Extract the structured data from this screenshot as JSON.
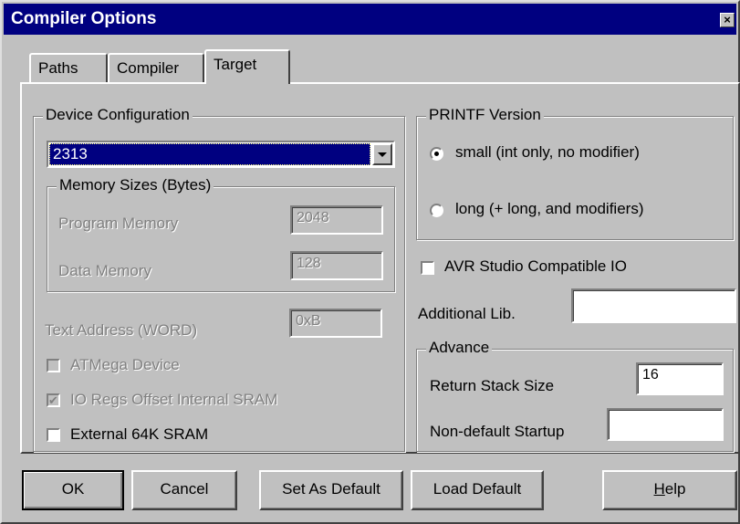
{
  "window": {
    "title": "Compiler Options",
    "close_glyph": "×"
  },
  "tabs": [
    {
      "label": "Paths"
    },
    {
      "label": "Compiler"
    },
    {
      "label": "Target"
    }
  ],
  "device_config": {
    "title": "Device Configuration",
    "device_value": "2313",
    "memory": {
      "title": "Memory Sizes (Bytes)",
      "program_label": "Program Memory",
      "program_value": "2048",
      "data_label": "Data Memory",
      "data_value": "128"
    },
    "text_address_label": "Text Address (WORD)",
    "text_address_value": "0xB",
    "atmega_label": "ATMega Device",
    "ioregs_label": "IO Regs Offset Internal SRAM",
    "ioregs_checked": true,
    "ext_sram_label": "External 64K SRAM",
    "ext_sram_checked": false
  },
  "printf": {
    "title": "PRINTF Version",
    "small_label": "small (int only, no modifier)",
    "long_label": "long (+ long, and modifiers)",
    "selected": "small"
  },
  "avr_studio": {
    "label": "AVR Studio Compatible IO",
    "checked": false
  },
  "additional_lib": {
    "label": "Additional Lib.",
    "value": ""
  },
  "advance": {
    "title": "Advance",
    "stack_label": "Return Stack Size",
    "stack_value": "16",
    "startup_label": "Non-default Startup",
    "startup_value": ""
  },
  "buttons": {
    "ok": "OK",
    "cancel": "Cancel",
    "set_default": "Set As Default",
    "load_default": "Load Default",
    "help_first": "H",
    "help_rest": "elp"
  },
  "icons": {
    "check_mark": "✔",
    "close": "close-icon",
    "dropdown": "chevron-down-icon"
  }
}
